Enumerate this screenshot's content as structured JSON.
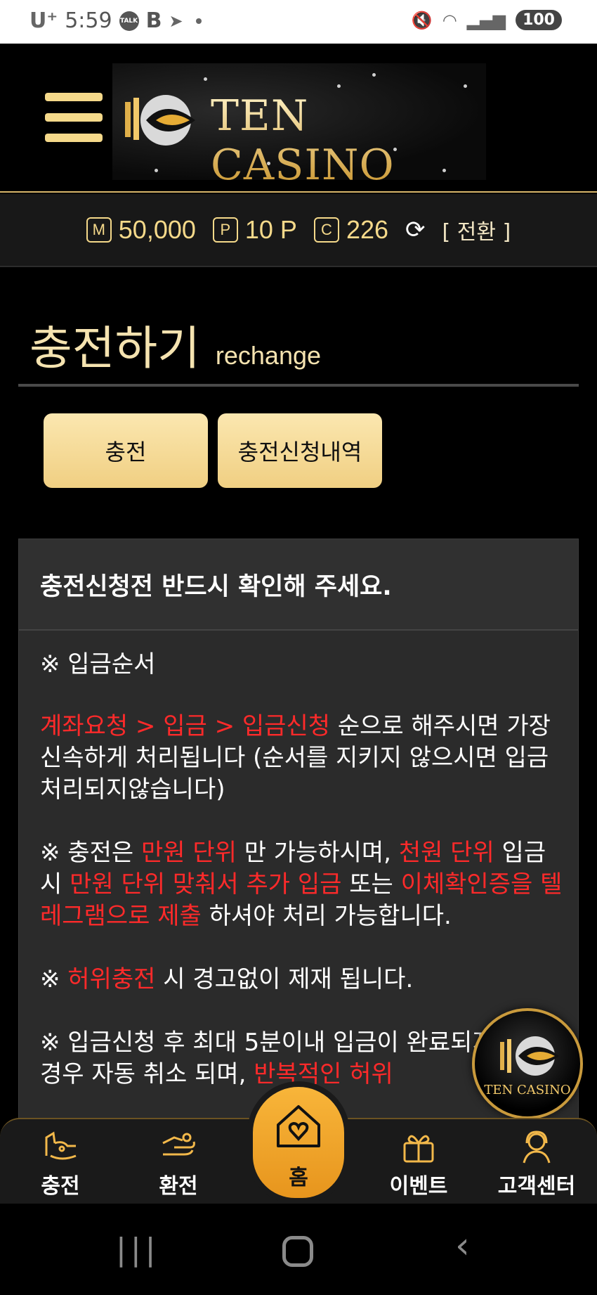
{
  "status_bar": {
    "carrier": "U⁺",
    "time": "5:59",
    "talk_icon": "TALK",
    "b_icon": "B",
    "battery": "100"
  },
  "header": {
    "logo_text": "TEN CASINO"
  },
  "balance": {
    "money_badge": "M",
    "money": "50,000",
    "point_badge": "P",
    "point": "10 P",
    "coin_badge": "C",
    "coin": "226",
    "switch_label": "[ 전환 ]"
  },
  "page": {
    "title": "충전하기",
    "subtitle": "rechange"
  },
  "tabs": {
    "charge": "충전",
    "history": "충전신청내역"
  },
  "notice": {
    "heading": "충전신청전 반드시 확인해 주세요.",
    "p1_head": "※ 입금순서",
    "p2_red": "계좌요청 > 입금 > 입금신청",
    "p2_rest": " 순으로 해주시면 가장 신속하게 처리됩니다 (순서를 지키지 않으시면 입금처리되지않습니다)",
    "p3_a": "※ 충전은 ",
    "p3_b": "만원 단위",
    "p3_c": " 만 가능하시며, ",
    "p3_d": "천원 단위",
    "p3_e": " 입금 시 ",
    "p3_f": "만원 단위 맞춰서 추가 입금",
    "p3_g": " 또는 ",
    "p3_h": "이체확인증을 텔레그램으로 제출",
    "p3_i": " 하셔야 처리 가능합니다.",
    "p4_a": "※ ",
    "p4_b": "허위충전",
    "p4_c": " 시 경고없이 제재 됩니다.",
    "p5_a": "※ 입금신청 후 최대 5분이내 입금이 완료되지 않을 경우 자동 취소 되며, ",
    "p5_b": "반복적인 허위"
  },
  "float_badge": {
    "text": "TEN CASINO"
  },
  "bottom_nav": {
    "charge": "충전",
    "exchange": "환전",
    "home": "홈",
    "event": "이벤트",
    "support": "고객센터"
  },
  "colors": {
    "gold": "#f5d98a",
    "accent_orange": "#f2a52a",
    "warning_red": "#ff2a2a",
    "panel": "#2b2b2b"
  }
}
